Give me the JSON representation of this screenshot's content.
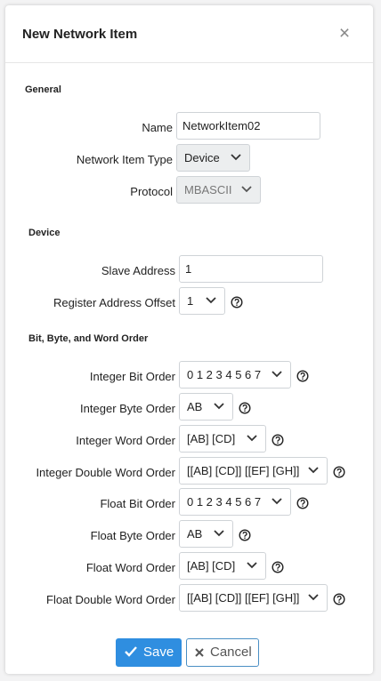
{
  "dialog": {
    "title": "New Network Item",
    "close_symbol": "×"
  },
  "sections": {
    "general": "General",
    "device": "Device",
    "order": "Bit, Byte, and Word Order"
  },
  "general": {
    "name_label": "Name",
    "name_value": "NetworkItem02",
    "type_label": "Network Item Type",
    "type_value": "Device",
    "protocol_label": "Protocol",
    "protocol_value": "MBASCII"
  },
  "device": {
    "slave_label": "Slave Address",
    "slave_value": "1",
    "offset_label": "Register Address Offset",
    "offset_value": "1"
  },
  "order": {
    "int_bit_label": "Integer Bit Order",
    "int_bit_value": "0 1 2 3 4 5 6 7",
    "int_byte_label": "Integer Byte Order",
    "int_byte_value": "AB",
    "int_word_label": "Integer Word Order",
    "int_word_value": "[AB] [CD]",
    "int_dword_label": "Integer Double Word Order",
    "int_dword_value": "[[AB] [CD]] [[EF] [GH]]",
    "float_bit_label": "Float Bit Order",
    "float_bit_value": "0 1 2 3 4 5 6 7",
    "float_byte_label": "Float Byte Order",
    "float_byte_value": "AB",
    "float_word_label": "Float Word Order",
    "float_word_value": "[AB] [CD]",
    "float_dword_label": "Float Double Word Order",
    "float_dword_value": "[[AB] [CD]] [[EF] [GH]]"
  },
  "footer": {
    "save_label": "Save",
    "cancel_label": "Cancel"
  },
  "icons": {
    "chevron": "chevron-down-icon",
    "help": "question-circle-icon",
    "save": "check-icon",
    "cancel": "x-icon",
    "close": "close-icon"
  },
  "colors": {
    "primary": "#2f8ee0",
    "cancel_border": "#4a8fc4"
  }
}
